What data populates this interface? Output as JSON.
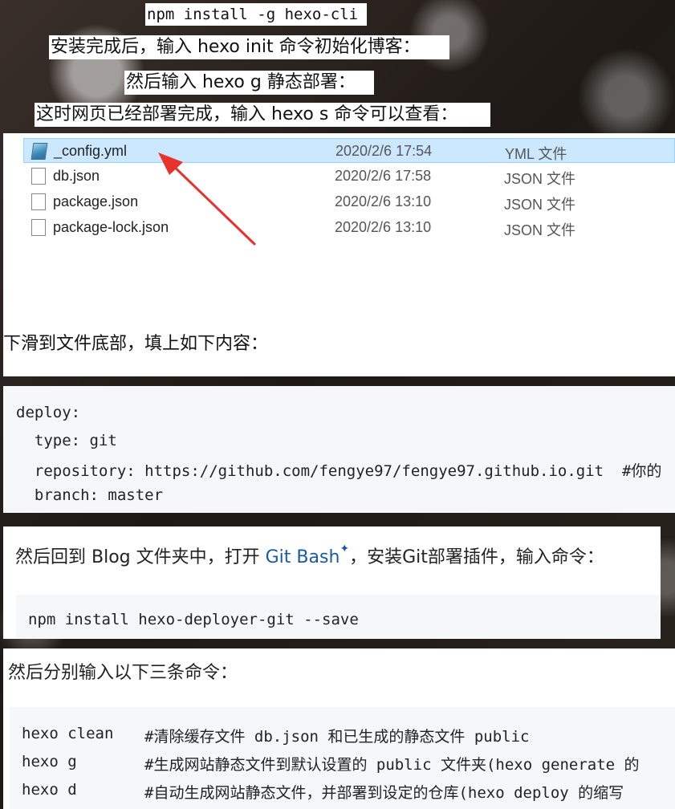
{
  "banners": {
    "install_cmd": "npm install -g hexo-cli",
    "after_install": "安装完成后，输入 hexo init 命令初始化博客：",
    "then_generate": "然后输入 hexo g 静态部署：",
    "view_site": "这时网页已经部署完成，输入 hexo s 命令可以查看："
  },
  "explorer": {
    "files": [
      {
        "name": "_config.yml",
        "date": "2020/2/6 17:54",
        "type": "YML 文件",
        "icon": "yml-file-icon",
        "selected": true
      },
      {
        "name": "db.json",
        "date": "2020/2/6 17:58",
        "type": "JSON 文件",
        "icon": "document-icon",
        "selected": false
      },
      {
        "name": "package.json",
        "date": "2020/2/6 13:10",
        "type": "JSON 文件",
        "icon": "document-icon",
        "selected": false
      },
      {
        "name": "package-lock.json",
        "date": "2020/2/6 13:10",
        "type": "JSON 文件",
        "icon": "document-icon",
        "selected": false
      }
    ],
    "selection_color": "#cce8ff",
    "annotation_arrow_color": "#e8322b"
  },
  "section1": {
    "text": "下滑到文件底部，填上如下内容：",
    "code_lines": [
      "deploy:",
      "  type: git",
      "  repository: https://github.com/fengye97/fengye97.github.io.git  #你的",
      "  branch: master"
    ]
  },
  "section2": {
    "text_before": "然后回到 Blog 文件夹中，打开 ",
    "link": "Git Bash",
    "link_mark": "✦",
    "text_after": "，安装Git部署插件，输入命令：",
    "code": "npm install hexo-deployer-git --save",
    "link_color": "#1a5aa0"
  },
  "section3": {
    "text": "然后分别输入以下三条命令：",
    "commands": [
      {
        "cmd": "hexo clean",
        "comment": "#清除缓存文件 db.json 和已生成的静态文件 public"
      },
      {
        "cmd": "hexo g",
        "comment": "#生成网站静态文件到默认设置的 public 文件夹(hexo generate 的"
      },
      {
        "cmd": "hexo d",
        "comment": "#自动生成网站静态文件，并部署到设定的仓库(hexo deploy 的缩写"
      }
    ]
  }
}
